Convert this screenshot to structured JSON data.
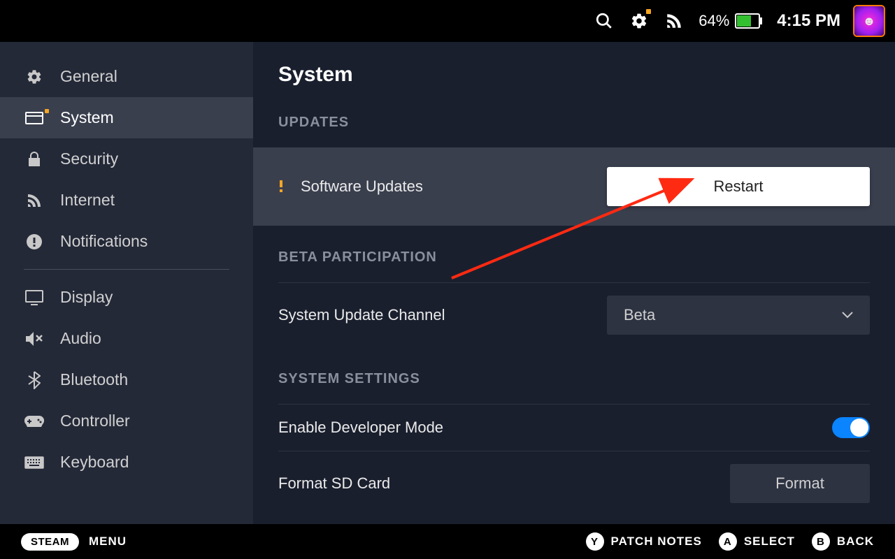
{
  "statusbar": {
    "battery_pct": "64%",
    "time": "4:15 PM"
  },
  "sidebar": {
    "items": [
      {
        "label": "General"
      },
      {
        "label": "System"
      },
      {
        "label": "Security"
      },
      {
        "label": "Internet"
      },
      {
        "label": "Notifications"
      },
      {
        "label": "Display"
      },
      {
        "label": "Audio"
      },
      {
        "label": "Bluetooth"
      },
      {
        "label": "Controller"
      },
      {
        "label": "Keyboard"
      }
    ]
  },
  "content": {
    "page_title": "System",
    "sections": {
      "updates": {
        "heading": "UPDATES",
        "software_updates_label": "Software Updates",
        "restart_label": "Restart"
      },
      "beta": {
        "heading": "BETA PARTICIPATION",
        "channel_label": "System Update Channel",
        "channel_value": "Beta"
      },
      "system_settings": {
        "heading": "SYSTEM SETTINGS",
        "developer_label": "Enable Developer Mode",
        "format_label": "Format SD Card",
        "format_button": "Format"
      }
    }
  },
  "bottombar": {
    "steam": "STEAM",
    "menu": "MENU",
    "y_label": "PATCH NOTES",
    "a_label": "SELECT",
    "b_label": "BACK"
  }
}
